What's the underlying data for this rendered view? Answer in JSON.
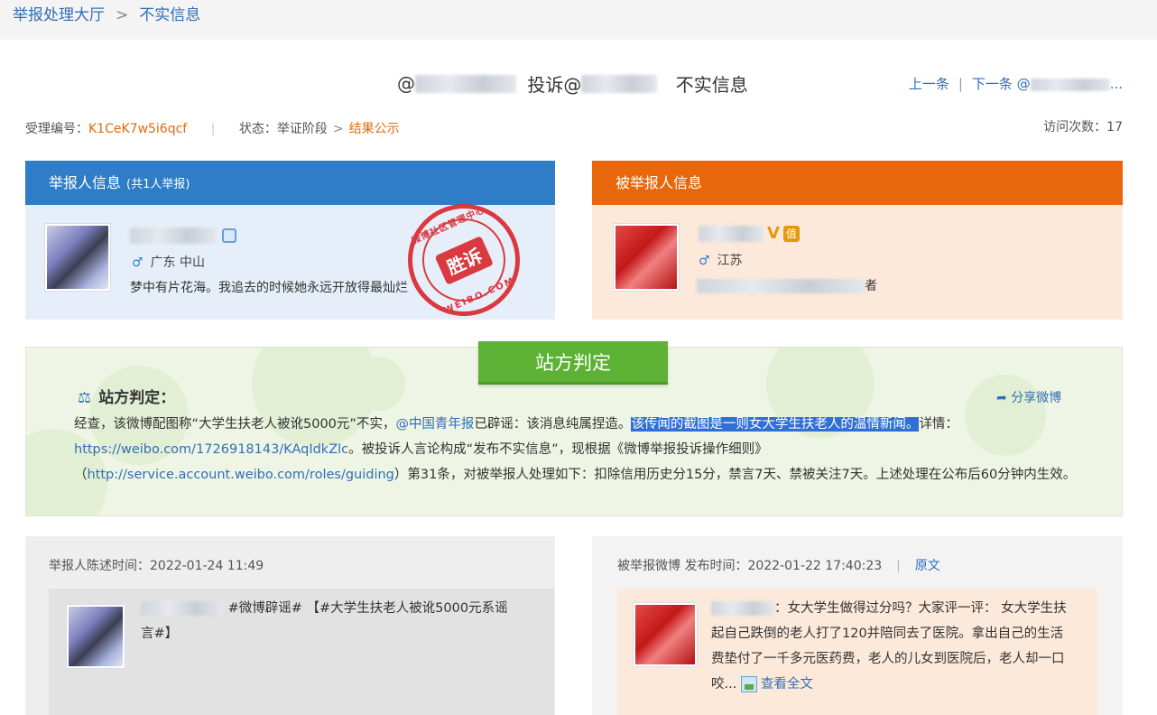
{
  "breadcrumb": {
    "home": "举报处理大厅",
    "separator": ">",
    "current": "不实信息"
  },
  "header": {
    "title_prefix": "@",
    "title_mid": "投诉@",
    "title_suffix": "不实信息",
    "prev_label": "上一条",
    "nav_separator": "|",
    "next_label": "下一条 @",
    "next_truncated": "..."
  },
  "meta": {
    "case_label": "受理编号：",
    "case_id": "K1CeK7w5i6qcf",
    "status_label": "状态：",
    "status_stage": "举证阶段",
    "status_arrow": ">",
    "status_result": "结果公示",
    "visits_label": "访问次数：",
    "visits_count": "17"
  },
  "reporter_panel": {
    "title": "举报人信息",
    "count": "(共1人举报)",
    "gender_symbol": "♂",
    "location": "广东 中山",
    "bio": "梦中有片花海。我追去的时候她永远开放得最灿烂"
  },
  "stamp": {
    "ring_text": "微博社区管理中心",
    "bottom_text": "WEIBO.COM",
    "word": "胜诉"
  },
  "reported_panel": {
    "title": "被举报人信息",
    "v_badge": "V",
    "gender_symbol": "♂",
    "location": "江苏",
    "bio_tail": "者",
    "badge2": "值"
  },
  "verdict": {
    "tab": "站方判定",
    "label": "站方判定：",
    "share": "分享微博",
    "p1": "经查，该微博配图称“大学生扶老人被讹5000元”不实，",
    "mention": "@中国青年报",
    "p2": "已辟谣：该消息纯属捏造。",
    "highlight": "该传闻的截图是一则女大学生扶老人的温情新闻。",
    "p3": "详情：",
    "url1": "https://weibo.com/1726918143/KAqIdkZlc",
    "p4": "。被投诉人言论构成“发布不实信息”，现根据《微博举报投诉操作细则》（",
    "url2": "http://service.account.weibo.com/roles/guiding",
    "p5": "）第31条，对被举报人处理如下：扣除信用历史分15分，禁言7天、禁被关注7天。上述处理在公布后60分钟内生效。"
  },
  "reporter_statement": {
    "time_label": "举报人陈述时间：",
    "time": "2022-01-24 11:49",
    "text": "#微博辟谣# 【#大学生扶老人被讹5000元系谣言#】"
  },
  "reported_post": {
    "time_label": "被举报微博 发布时间：",
    "time": "2022-01-22 17:40:23",
    "separator": "|",
    "original_link": "原文",
    "text": "：女大学生做得过分吗？大家评一评： 女大学生扶起自己跌倒的老人打了120并陪同去了医院。拿出自己的生活费垫付了一千多元医药费，老人的儿女到医院后，老人却一口咬...",
    "full_text_link": "查看全文"
  },
  "colors": {
    "reporter_header": "#2f7dc6",
    "reported_header": "#e9670c",
    "verdict_tab": "#5db135",
    "link": "#2e6fb7",
    "case_id": "#e36a0c",
    "stamp": "#d9262d"
  }
}
